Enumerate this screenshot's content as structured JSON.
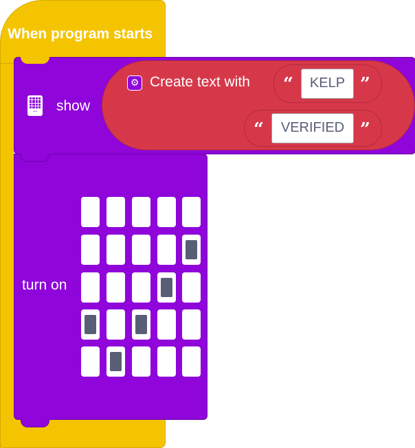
{
  "hat_block": {
    "title": "When program starts"
  },
  "show_block": {
    "label": "show",
    "icon": "microbit-device-icon"
  },
  "join_block": {
    "label": "Create text with",
    "icon": "gear-icon",
    "items": [
      "KELP",
      "VERIFIED"
    ],
    "open_quote": "“",
    "close_quote": "”"
  },
  "turn_on_block": {
    "label": "turn on",
    "grid": [
      [
        0,
        0,
        0,
        0,
        0
      ],
      [
        0,
        0,
        0,
        0,
        1
      ],
      [
        0,
        0,
        0,
        1,
        0
      ],
      [
        1,
        0,
        1,
        0,
        0
      ],
      [
        0,
        1,
        0,
        0,
        0
      ]
    ]
  },
  "colors": {
    "hat": "#f5c400",
    "block": "#8f05da",
    "join": "#d6384a",
    "led_on": "#575e75"
  }
}
